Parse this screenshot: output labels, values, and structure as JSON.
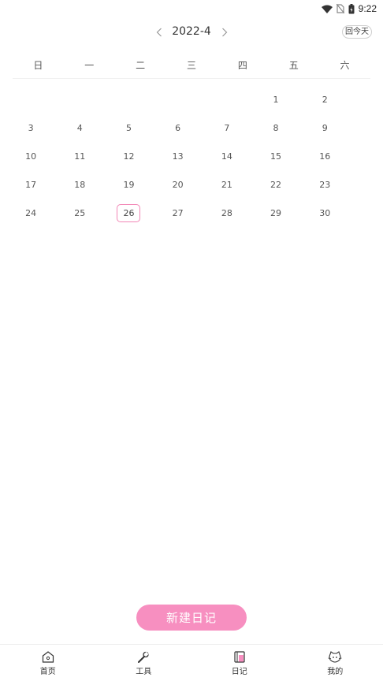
{
  "status_bar": {
    "time": "9:22"
  },
  "header": {
    "month_label": "2022-4",
    "today_button": "回今天"
  },
  "weekdays": [
    "日",
    "一",
    "二",
    "三",
    "四",
    "五",
    "六"
  ],
  "calendar": {
    "days": [
      "",
      "",
      "",
      "",
      "",
      "1",
      "2",
      "3",
      "4",
      "5",
      "6",
      "7",
      "8",
      "9",
      "10",
      "11",
      "12",
      "13",
      "14",
      "15",
      "16",
      "17",
      "18",
      "19",
      "20",
      "21",
      "22",
      "23",
      "24",
      "25",
      "26",
      "27",
      "28",
      "29",
      "30"
    ],
    "selected_day": "26",
    "accent_color": "#f286b6"
  },
  "actions": {
    "new_diary": "新建日记"
  },
  "bottom_nav": {
    "items": [
      {
        "label": "首页",
        "icon": "home-icon"
      },
      {
        "label": "工具",
        "icon": "wrench-icon"
      },
      {
        "label": "日记",
        "icon": "diary-icon"
      },
      {
        "label": "我的",
        "icon": "cat-face-icon"
      }
    ],
    "active_index": 2,
    "active_color": "#f78fc0"
  }
}
